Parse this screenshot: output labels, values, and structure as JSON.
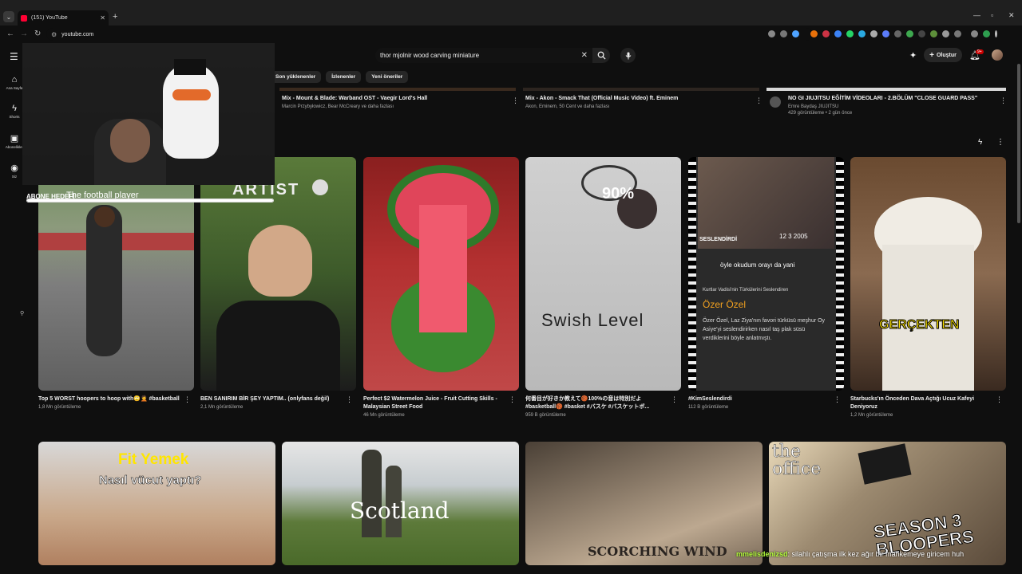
{
  "browser": {
    "tab_title": "(151) YouTube",
    "url": "youtube.com"
  },
  "header": {
    "search_query": "thor mjolnir wood carving miniature",
    "create_label": "Oluştur",
    "notifications_badge": "9+"
  },
  "guide": [
    {
      "icon": "home-icon",
      "label": "Ana Sayfa"
    },
    {
      "icon": "shorts-icon",
      "label": "Shorts"
    },
    {
      "icon": "subscriptions-icon",
      "label": "Abonelikler"
    },
    {
      "icon": "you-icon",
      "label": "Siz"
    }
  ],
  "chips": [
    "Son yüklenenler",
    "İzlenenler",
    "Yeni öneriler"
  ],
  "top_row": [
    {
      "title": "Mix - Mount & Blade: Warband OST - Vaegir Lord's Hall",
      "meta": "Marcin Przybyłowicz, Bear McCreary ve daha fazlası"
    },
    {
      "title": "Mix - Akon - Smack That (Official Music Video) ft. Eminem",
      "meta": "Akon, Eminem, 50 Cent ve daha fazlası"
    },
    {
      "title": "NO GI JIUJITSU EĞİTİM VİDEOLARI - 2.BÖLÜM \"CLOSE GUARD PASS\"",
      "channel": "Emre Baydaş JIUJITSU",
      "meta": "429 görüntüleme • 2 gün önce"
    }
  ],
  "shorts": [
    {
      "title": "Top 5 WORST hoopers to hoop with🙄🤦 #basketball",
      "views": "1,8 Mn görüntüleme",
      "overlay": ""
    },
    {
      "title": "BEN SANIRIM BİR ŞEY YAPTIM.. (onlyfans değil)",
      "views": "2,1 Mn görüntüleme",
      "overlay": "ARTIST"
    },
    {
      "title": "Perfect $2 Watermelon Juice - Fruit Cutting Skills - Malaysian Street Food",
      "views": "46 Mn görüntüleme",
      "overlay": ""
    },
    {
      "title": "何番目が好きか教えて🏀100%の音は特別だよ #basketball🏀 #basket #バスケ #バスケットボ...",
      "views": "959 B görüntüleme",
      "overlay": "Swish Level",
      "overlay2": "90%"
    },
    {
      "title": "#KimSeslendirdi",
      "views": "112 B görüntüleme",
      "overlay": "Özer Özel",
      "overlay2": "öyle okudum orayı da yani",
      "overlay3": "Kurtlar Vadisi'nin Türkülerini Seslendiren",
      "overlay4": "Özer Özel, Laz Ziya'nın favori türküsü meşhur Oy Asiye'yi seslendirirken nasıl taş plak süsü verdiklerini böyle anlatmıştı.",
      "overlay5": "SESLENDİRDİ",
      "overlay6": "12 3 2005"
    },
    {
      "title": "Starbucks'ın Önceden Dava Açtığı Ucuz Kafeyi Deniyoruz",
      "views": "1,2 Mn görüntüleme",
      "overlay": "GERÇEKTEN"
    }
  ],
  "bottom_row": [
    {
      "overlay": "Fit Yemek",
      "overlay2": "Nasıl vücut yaptı?"
    },
    {
      "overlay": "Scotland"
    },
    {
      "overlay": "SCORCHING WIND"
    },
    {
      "overlay": "the office",
      "overlay2": "SEASON 3 BLOOPERS"
    }
  ],
  "stream": {
    "goal_label": "ABONE HEDEFİ",
    "goal_text": "The football player",
    "goal_progress": 1.0,
    "chat_user": "mmelisdenizsd",
    "chat_message": ": silahlı çatışma ilk kez ağır bir mahkemeye giricem huh"
  },
  "colors": {
    "background": "#0f0f0f",
    "accent": "#ff0033",
    "chat_user": "#b4ff3a"
  }
}
